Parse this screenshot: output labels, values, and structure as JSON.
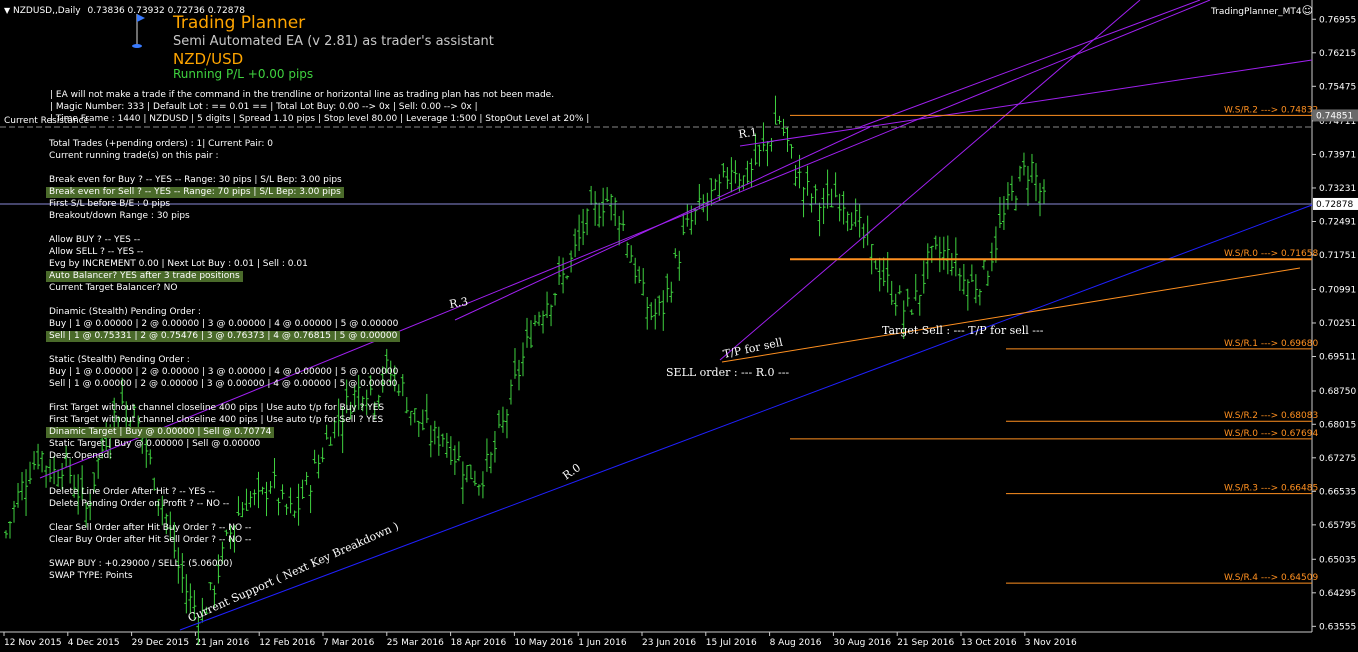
{
  "header": {
    "symbol_tf": "NZDUSD,,Daily",
    "ohlc": "0.73836 0.73932 0.72736 0.72878",
    "indicator_name": "TradingPlanner_MT4",
    "smiley": "☺"
  },
  "planner": {
    "title": "Trading Planner",
    "subtitle": "Semi Automated EA (v 2.81) as trader's assistant",
    "pair": "NZD/USD",
    "running_pl": "Running P/L +0.00 pips"
  },
  "info_lines": [
    {
      "text": "| EA will not make a trade if the command in the trendline or horizontal line as trading plan has not been made.",
      "hl": false
    },
    {
      "text": "| Magic Number: 333 | Default Lot : == 0.01 == | Total Lot Buy: 0.00 --> 0x | Sell: 0.00 --> 0x |",
      "hl": false
    },
    {
      "text": "| Time Frame : 1440 | NZDUSD | 5 digits | Spread 1.10 pips | Stop level 80.00 | Leverage  1:500 | StopOut Level at 20% |",
      "hl": false
    }
  ],
  "current_resistance_label": "Current Resistance",
  "status_lines": [
    {
      "text": "Total Trades (+pending orders) : 1| Current Pair: 0",
      "hl": false
    },
    {
      "text": "Current running trade(s) on this pair :",
      "hl": false
    },
    {
      "text": "",
      "hl": false
    },
    {
      "text": "Break even for Buy ? -- YES -- Range: 30 pips | S/L Bep: 3.00 pips",
      "hl": false
    },
    {
      "text": "Break even for Sell ? -- YES -- Range: 70 pips | S/L Bep: 3.00 pips",
      "hl": true
    },
    {
      "text": "First S/L before B/E : 0 pips",
      "hl": false
    },
    {
      "text": "Breakout/down Range : 30 pips",
      "hl": false
    },
    {
      "text": "",
      "hl": false
    },
    {
      "text": "Allow BUY ? -- YES --",
      "hl": false
    },
    {
      "text": "Allow SELL ? -- YES --",
      "hl": false
    },
    {
      "text": "Evg by INCREMENT 0.00 | Next Lot Buy : 0.01 | Sell : 0.01",
      "hl": false
    },
    {
      "text": "Auto Balancer? YES after 3 trade positions",
      "hl": true
    },
    {
      "text": "Current Target Balancer? NO",
      "hl": false
    },
    {
      "text": "",
      "hl": false
    },
    {
      "text": "Dinamic (Stealth) Pending Order :",
      "hl": false
    },
    {
      "text": "    Buy    | 1 @ 0.00000 | 2 @ 0.00000 | 3 @ 0.00000 | 4 @ 0.00000 | 5 @ 0.00000",
      "hl": false
    },
    {
      "text": "    Sell    | 1 @ 0.75331 | 2 @ 0.75476 | 3 @ 0.76373 | 4 @ 0.76815 | 5 @ 0.00000",
      "hl": true
    },
    {
      "text": "",
      "hl": false
    },
    {
      "text": "Static (Stealth) Pending Order :",
      "hl": false
    },
    {
      "text": "    Buy    | 1 @ 0.00000 | 2 @ 0.00000 | 3 @ 0.00000 | 4 @ 0.00000 | 5 @ 0.00000",
      "hl": false
    },
    {
      "text": "    Sell    | 1 @ 0.00000 | 2 @ 0.00000 | 3 @ 0.00000 | 4 @ 0.00000 | 5 @ 0.00000",
      "hl": false
    },
    {
      "text": "",
      "hl": false
    },
    {
      "text": "First Target without channel closeline 400 pips | Use auto t/p for Buy ? YES",
      "hl": false
    },
    {
      "text": "First Target without channel closeline 400 pips | Use auto t/p for Sell ? YES",
      "hl": false
    },
    {
      "text": "Dinamic Target  | Buy @ 0.00000 | Sell @ 0.70774",
      "hl": true
    },
    {
      "text": "Static Target    | Buy @ 0.00000 | Sell @ 0.00000",
      "hl": false
    },
    {
      "text": "Desc.Opened:",
      "hl": false
    },
    {
      "text": "",
      "hl": false
    },
    {
      "text": "",
      "hl": false
    },
    {
      "text": "Delete Line Order After Hit ? -- YES --",
      "hl": false
    },
    {
      "text": "Delete Pending Order on Profit ? -- NO --",
      "hl": false
    },
    {
      "text": "",
      "hl": false
    },
    {
      "text": "Clear Sell Order after Hit Buy Order ? -- NO --",
      "hl": false
    },
    {
      "text": "Clear Buy Order after Hit Sell Order ? -- NO --",
      "hl": false
    },
    {
      "text": "",
      "hl": false
    },
    {
      "text": "SWAP BUY : +0.29000 / SELL : (5.06000)",
      "hl": false
    },
    {
      "text": "SWAP TYPE: Points",
      "hl": false
    }
  ],
  "chart_labels": {
    "r1": "R.1",
    "r3": "R.3",
    "r0": "R.0",
    "tp_sell": "T/P for sell",
    "sell_order": "SELL order : --- R.0 ---",
    "target_sell": "Target Sell : --- T/P for sell ---",
    "support": "Current Support ( Next Key Breakdown )"
  },
  "levels": [
    {
      "label": "W.S/R.2 ---> 0.74832",
      "price": 0.74832,
      "box": "0.74851"
    },
    {
      "label": "W.S/R.0 ---> 0.71658",
      "price": 0.71658
    },
    {
      "label": "W.S/R.1 ---> 0.69680",
      "price": 0.6968
    },
    {
      "label": "W.S/R.2 ---> 0.68083",
      "price": 0.68083
    },
    {
      "label": "W.S/R.0 ---> 0.67694",
      "price": 0.67694
    },
    {
      "label": "W.S/R.3 ---> 0.66485",
      "price": 0.66485
    },
    {
      "label": "W.S/R.4 ---> 0.64509",
      "price": 0.64509
    }
  ],
  "current_price": "0.72878",
  "chart_data": {
    "type": "candlestick",
    "symbol": "NZDUSD",
    "timeframe": "Daily",
    "y_ticks": [
      "0.76955",
      "0.76215",
      "0.75475",
      "0.74711",
      "0.73971",
      "0.73231",
      "0.72491",
      "0.71751",
      "0.70991",
      "0.70251",
      "0.69511",
      "0.68750",
      "0.68015",
      "0.67275",
      "0.66535",
      "0.65795",
      "0.65035",
      "0.64295",
      "0.63555"
    ],
    "x_ticks": [
      "12 Nov 2015",
      "4 Dec 2015",
      "29 Dec 2015",
      "21 Jan 2016",
      "12 Feb 2016",
      "7 Mar 2016",
      "25 Mar 2016",
      "18 Apr 2016",
      "10 May 2016",
      "1 Jun 2016",
      "23 Jun 2016",
      "15 Jul 2016",
      "8 Aug 2016",
      "30 Aug 2016",
      "21 Sep 2016",
      "13 Oct 2016",
      "3 Nov 2016"
    ],
    "ylim": [
      0.6343,
      0.7738
    ],
    "closes": [
      0.656,
      0.664,
      0.67,
      0.674,
      0.669,
      0.672,
      0.667,
      0.661,
      0.672,
      0.68,
      0.685,
      0.683,
      0.676,
      0.667,
      0.659,
      0.648,
      0.641,
      0.638,
      0.644,
      0.653,
      0.66,
      0.664,
      0.663,
      0.668,
      0.662,
      0.66,
      0.666,
      0.671,
      0.678,
      0.682,
      0.686,
      0.689,
      0.687,
      0.692,
      0.69,
      0.684,
      0.68,
      0.677,
      0.678,
      0.673,
      0.67,
      0.668,
      0.672,
      0.679,
      0.688,
      0.696,
      0.704,
      0.708,
      0.711,
      0.716,
      0.723,
      0.727,
      0.73,
      0.728,
      0.72,
      0.71,
      0.704,
      0.706,
      0.715,
      0.723,
      0.727,
      0.73,
      0.732,
      0.738,
      0.734,
      0.738,
      0.742,
      0.748,
      0.74,
      0.733,
      0.73,
      0.728,
      0.731,
      0.729,
      0.723,
      0.718,
      0.713,
      0.709,
      0.705,
      0.708,
      0.716,
      0.718,
      0.717,
      0.712,
      0.711,
      0.714,
      0.722,
      0.729,
      0.735,
      0.737,
      0.7288
    ]
  }
}
